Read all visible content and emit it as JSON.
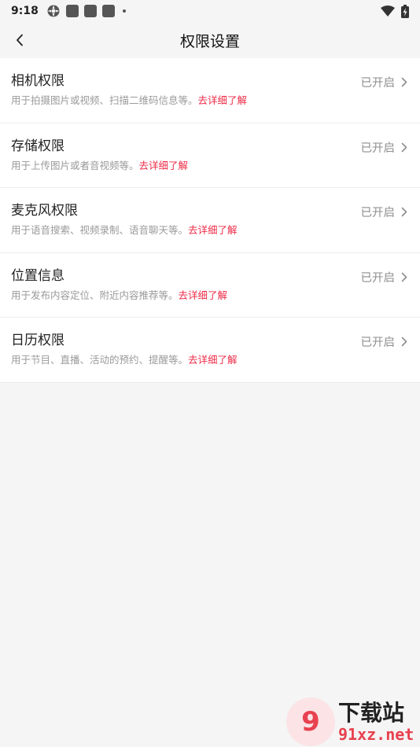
{
  "status_bar": {
    "time": "9:18"
  },
  "header": {
    "title": "权限设置"
  },
  "permissions": [
    {
      "title": "相机权限",
      "desc": "用于拍摄图片或视频、扫描二维码信息等。",
      "link": "去详细了解",
      "status": "已开启"
    },
    {
      "title": "存储权限",
      "desc": "用于上传图片或者音视频等。",
      "link": "去详细了解",
      "status": "已开启"
    },
    {
      "title": "麦克风权限",
      "desc": "用于语音搜索、视频录制、语音聊天等。",
      "link": "去详细了解",
      "status": "已开启"
    },
    {
      "title": "位置信息",
      "desc": "用于发布内容定位、附近内容推荐等。",
      "link": "去详细了解",
      "status": "已开启"
    },
    {
      "title": "日历权限",
      "desc": "用于节目、直播、活动的预约、提醒等。",
      "link": "去详细了解",
      "status": "已开启"
    }
  ],
  "watermark": {
    "cn": "下载站",
    "en": "91xz.net"
  },
  "colors": {
    "accent": "#ee2b47",
    "background": "#f5f5f5"
  }
}
